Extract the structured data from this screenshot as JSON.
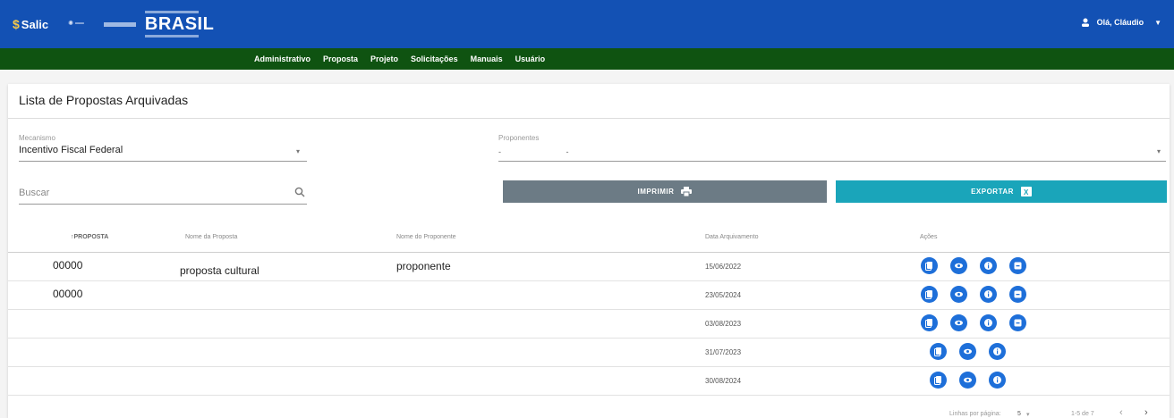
{
  "header": {
    "app_name": "Salic",
    "brand": "BRASIL",
    "user_name": "Olá, Cláudio",
    "colors": {
      "top": "#1351b4",
      "nav": "#0f5311",
      "accent": "#1e6fd9"
    }
  },
  "nav": {
    "items": [
      "Administrativo",
      "Proposta",
      "Projeto",
      "Solicitações",
      "Manuais",
      "Usuário"
    ]
  },
  "page": {
    "title": "Lista de Propostas Arquivadas"
  },
  "filters": {
    "mecanismo_label": "Mecanismo",
    "mecanismo_value": "Incentivo Fiscal Federal",
    "proponentes_label": "Proponentes",
    "proponentes_value": "- -",
    "buscar_placeholder": "Buscar"
  },
  "buttons": {
    "imprimir": "IMPRIMIR",
    "exportar": "EXPORTAR"
  },
  "table": {
    "headers": [
      "↑PROPOSTA",
      "Nome da Proposta",
      "Nome do Proponente",
      "Data Arquivamento",
      "Ações"
    ],
    "rows": [
      {
        "proposta": "00000",
        "nome": "proposta cultural",
        "proponente": "proponente",
        "data": "15/06/2022",
        "actions": [
          "copy-icon",
          "eye-icon",
          "info-icon",
          "unarchive-icon"
        ]
      },
      {
        "proposta": "00000",
        "nome": "",
        "proponente": "",
        "data": "23/05/2024",
        "actions": [
          "copy-icon",
          "eye-icon",
          "info-icon",
          "unarchive-icon"
        ]
      },
      {
        "proposta": "",
        "nome": "",
        "proponente": "",
        "data": "03/08/2023",
        "actions": [
          "copy-icon",
          "eye-icon",
          "info-icon",
          "unarchive-icon"
        ]
      },
      {
        "proposta": "",
        "nome": "",
        "proponente": "",
        "data": "31/07/2023",
        "actions": [
          "copy-icon",
          "eye-icon",
          "info-icon"
        ]
      },
      {
        "proposta": "",
        "nome": "",
        "proponente": "",
        "data": "30/08/2024",
        "actions": [
          "copy-icon",
          "eye-icon",
          "info-icon"
        ]
      }
    ]
  },
  "pagination": {
    "rows_per_page_label": "Linhas por página:",
    "rows_per_page": "5",
    "range": "1-5 de 7"
  }
}
